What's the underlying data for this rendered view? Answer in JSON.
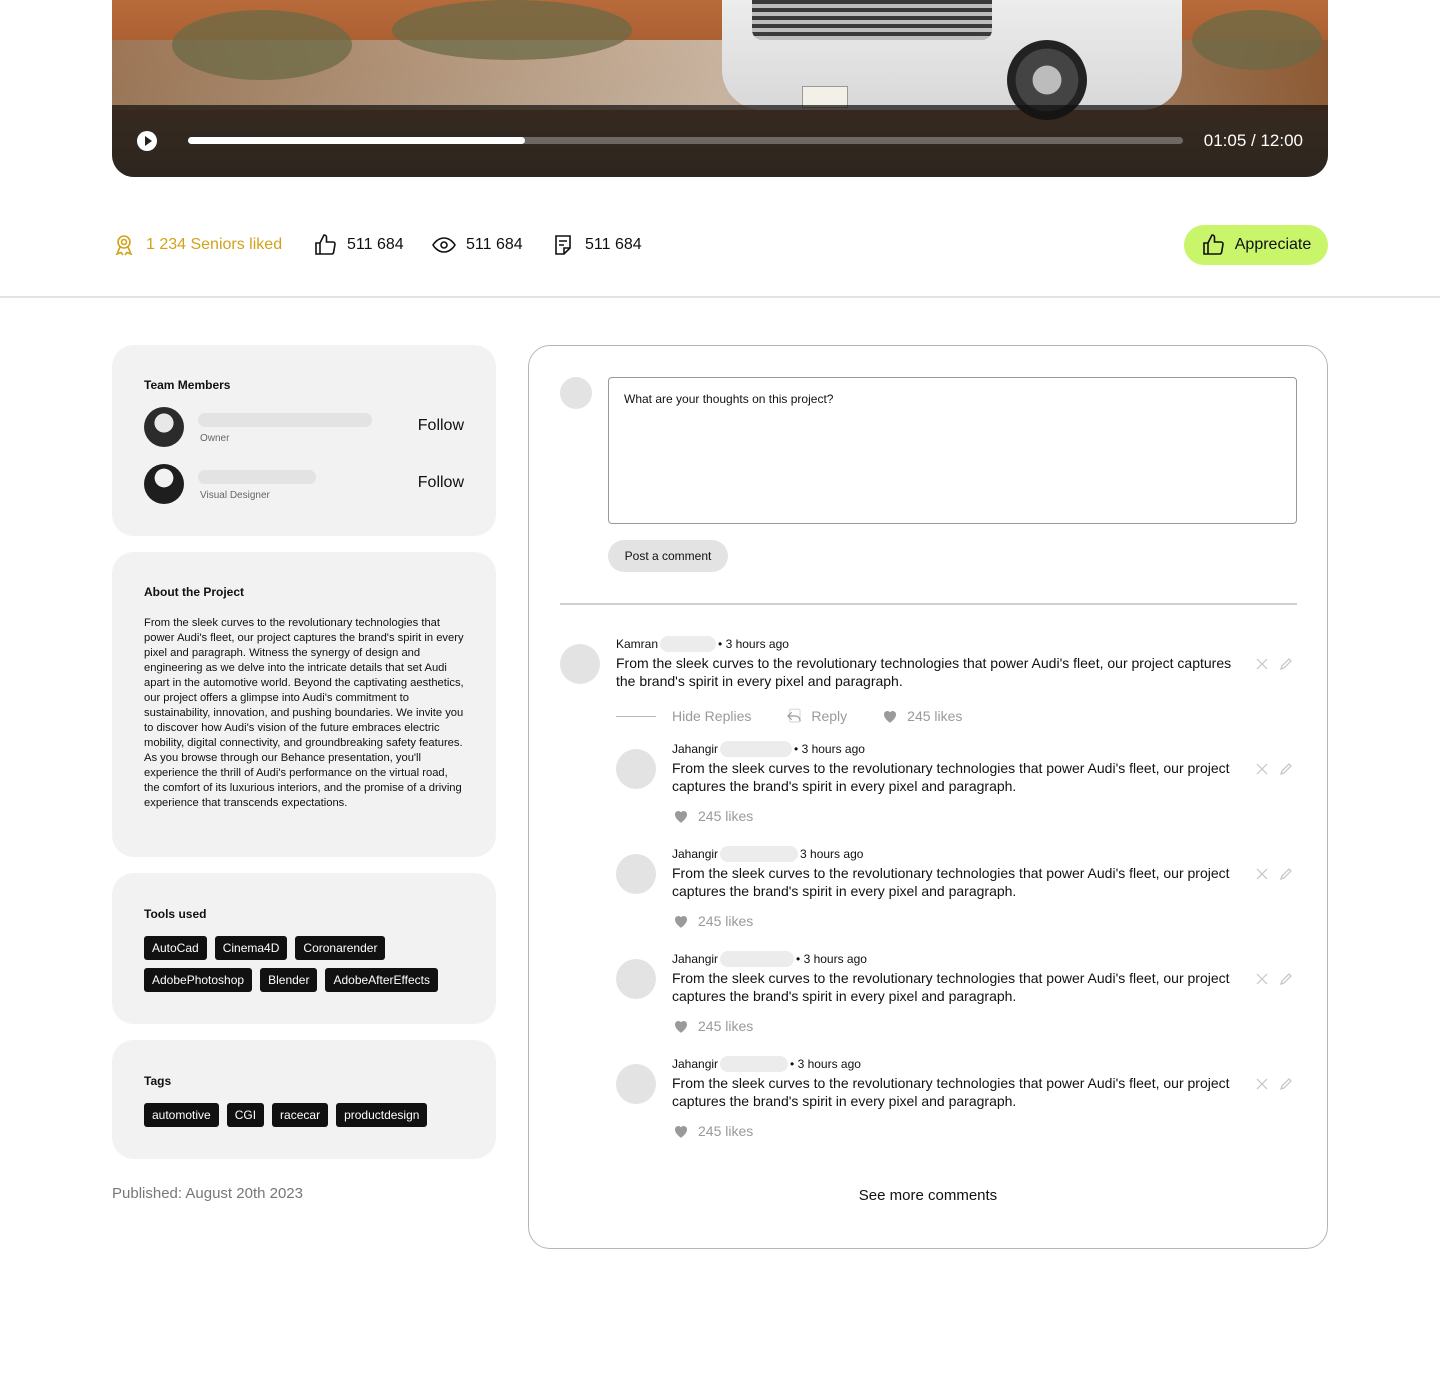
{
  "video": {
    "current_time": "01:05",
    "duration": "12:00",
    "time_label": "01:05 / 12:00",
    "progress": 0.339
  },
  "stats": {
    "seniors_liked": "1 234 Seniors liked",
    "likes": "511 684",
    "views": "511 684",
    "comments": "511 684",
    "appreciate_label": "Appreciate"
  },
  "colors": {
    "accent": "#c9f56b",
    "seniors": "#d1a21a",
    "card_bg": "#f2f2f2",
    "chip_bg": "#111111"
  },
  "team": {
    "title": "Team Members",
    "members": [
      {
        "role": "Owner",
        "follow_label": "Follow"
      },
      {
        "role": "Visual Designer",
        "follow_label": "Follow"
      }
    ]
  },
  "about": {
    "title": "About the Project",
    "text": "From the sleek curves to the revolutionary technologies that power Audi's fleet, our project captures the brand's spirit in every pixel and paragraph. Witness the synergy of design and engineering as we delve into the intricate details that set Audi apart in the automotive world. Beyond the captivating aesthetics, our project offers a glimpse into Audi's commitment to sustainability, innovation, and pushing boundaries. We invite you to discover how Audi's vision of the future embraces electric mobility, digital connectivity, and groundbreaking safety features. As you browse through our Behance presentation, you'll experience the thrill of Audi's performance on the virtual road, the comfort of its luxurious interiors, and the promise of a driving experience that transcends expectations."
  },
  "tools": {
    "title": "Tools used",
    "items": [
      "AutoCad",
      "Cinema4D",
      "Coronarender",
      "AdobePhotoshop",
      "Blender",
      "AdobeAfterEffects"
    ]
  },
  "tags": {
    "title": "Tags",
    "items": [
      "automotive",
      "CGI",
      "racecar",
      "productdesign"
    ]
  },
  "published": "Published: August 20th 2023",
  "comment_form": {
    "placeholder": "What are your thoughts on this project?",
    "post_label": "Post a comment"
  },
  "comments": {
    "main": {
      "author": "Kamran",
      "time": "• 3 hours ago",
      "text": "From the sleek curves to the revolutionary technologies that power Audi's fleet, our project captures the brand's spirit in every pixel and paragraph.",
      "hide_replies": "Hide Replies",
      "reply": "Reply",
      "likes": "245 likes"
    },
    "replies": [
      {
        "author": "Jahangir",
        "time": "• 3 hours ago",
        "text": "From the sleek curves to the revolutionary technologies that power Audi's fleet, our project captures the brand's spirit in every pixel and paragraph.",
        "likes": "245 likes"
      },
      {
        "author": "Jahangir",
        "time": "3 hours ago",
        "text": "From the sleek curves to the revolutionary technologies that power Audi's fleet, our project captures the brand's spirit in every pixel and paragraph.",
        "likes": "245 likes"
      },
      {
        "author": "Jahangir",
        "time": "• 3 hours ago",
        "text": "From the sleek curves to the revolutionary technologies that power Audi's fleet, our project captures the brand's spirit in every pixel and paragraph.",
        "likes": "245 likes"
      },
      {
        "author": "Jahangir",
        "time": "• 3 hours ago",
        "text": "From the sleek curves to the revolutionary technologies that power Audi's fleet, our project captures the brand's spirit in every pixel and paragraph.",
        "likes": "245 likes"
      }
    ],
    "see_more": "See more comments"
  }
}
